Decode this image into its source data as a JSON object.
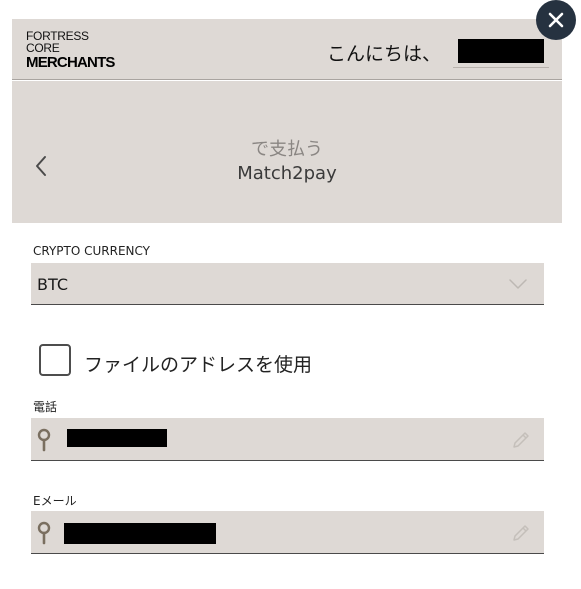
{
  "header": {
    "logo": {
      "line1": "FORTRESS",
      "line2": "CORE",
      "line3": "MERCHANTS"
    },
    "greeting": "こんにちは、"
  },
  "subheader": {
    "pay_title": "で支払う",
    "pay_method": "Match2pay"
  },
  "crypto": {
    "label": "CRYPTO CURRENCY",
    "selected": "BTC"
  },
  "address_checkbox": {
    "label": "ファイルのアドレスを使用",
    "checked": false
  },
  "phone": {
    "label": "電話"
  },
  "email": {
    "label": "Eメール"
  },
  "icons": {
    "close": "close-icon",
    "back": "chevron-left-icon",
    "dropdown": "chevron-down-icon",
    "field": "key-icon",
    "edit": "pencil-icon"
  },
  "colors": {
    "panel_bg": "#ded9d5",
    "close_bg": "#263240",
    "icon_brown": "#7a6f60"
  }
}
